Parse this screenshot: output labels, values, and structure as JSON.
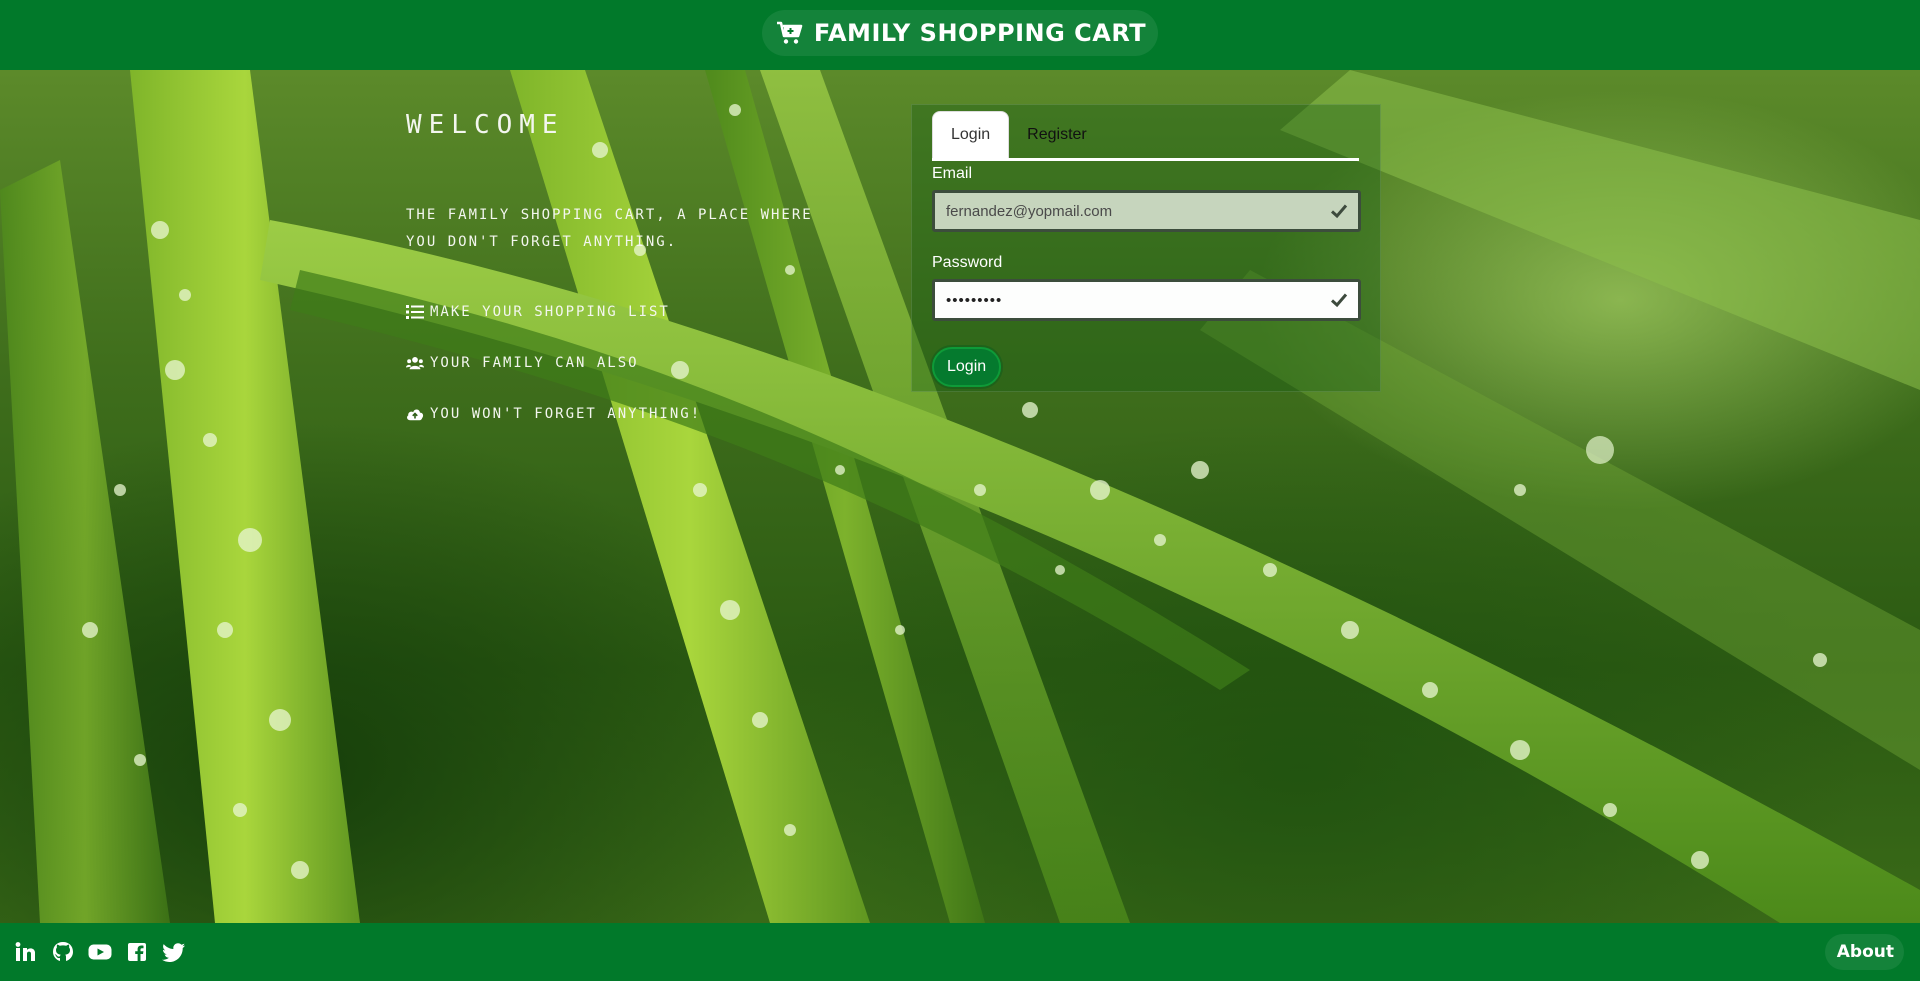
{
  "header": {
    "brand_title": "FAMILY SHOPPING CART",
    "brand_icon": "shopping-cart-plus-icon"
  },
  "welcome": {
    "title": "WELCOME",
    "description": "THE FAMILY SHOPPING CART, A PLACE WHERE YOU DON'T FORGET ANYTHING.",
    "features": [
      {
        "icon": "list-icon",
        "label": "MAKE YOUR SHOPPING LIST"
      },
      {
        "icon": "users-icon",
        "label": "YOUR FAMILY CAN ALSO"
      },
      {
        "icon": "cloud-upload-icon",
        "label": "YOU WON'T FORGET ANYTHING!"
      }
    ]
  },
  "auth": {
    "tabs": [
      {
        "label": "Login",
        "active": true
      },
      {
        "label": "Register",
        "active": false
      }
    ],
    "email_label": "Email",
    "email_value": "fernandez@yopmail.com",
    "password_label": "Password",
    "password_value": "•••••••••",
    "login_button": "Login"
  },
  "footer": {
    "social_icons": [
      "linkedin-icon",
      "github-icon",
      "youtube-icon",
      "facebook-icon",
      "twitter-icon"
    ],
    "about_label": "About"
  },
  "colors": {
    "bar_green": "#01792a",
    "button_green": "#057a2e",
    "email_field_bg": "#c6d5bd"
  }
}
